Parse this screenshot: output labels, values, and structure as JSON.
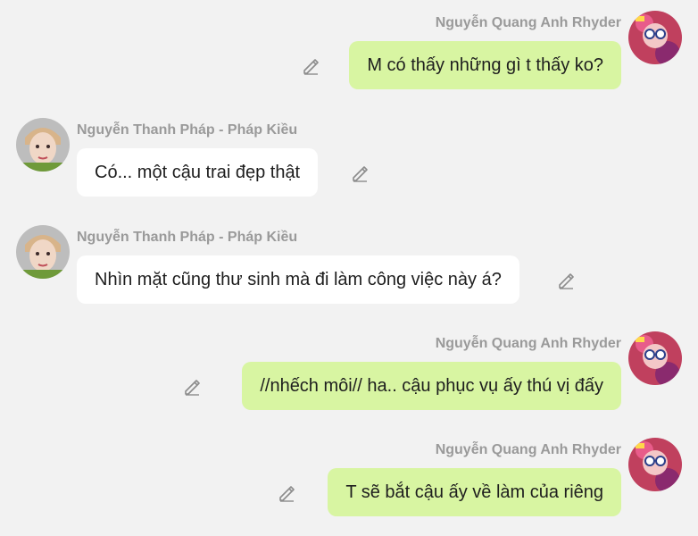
{
  "users": {
    "me": "Nguyễn Quang Anh Rhyder",
    "them": "Nguyễn Thanh Pháp - Pháp Kiều"
  },
  "messages": [
    {
      "text": "M có thấy những gì t thấy ko?"
    },
    {
      "text": "Có... một cậu trai đẹp thật"
    },
    {
      "text": "Nhìn mặt cũng thư sinh mà đi làm công việc này á?"
    },
    {
      "text": "//nhếch môi// ha.. cậu phục vụ ấy thú vị đấy"
    },
    {
      "text": "T sẽ bắt cậu ấy về làm của riêng"
    }
  ],
  "colors": {
    "background": "#f2f2f2",
    "outgoing_bubble": "#d8f5a2",
    "incoming_bubble": "#ffffff",
    "name_text": "#9a9a9a"
  },
  "icons": {
    "edit": "pencil-icon"
  }
}
